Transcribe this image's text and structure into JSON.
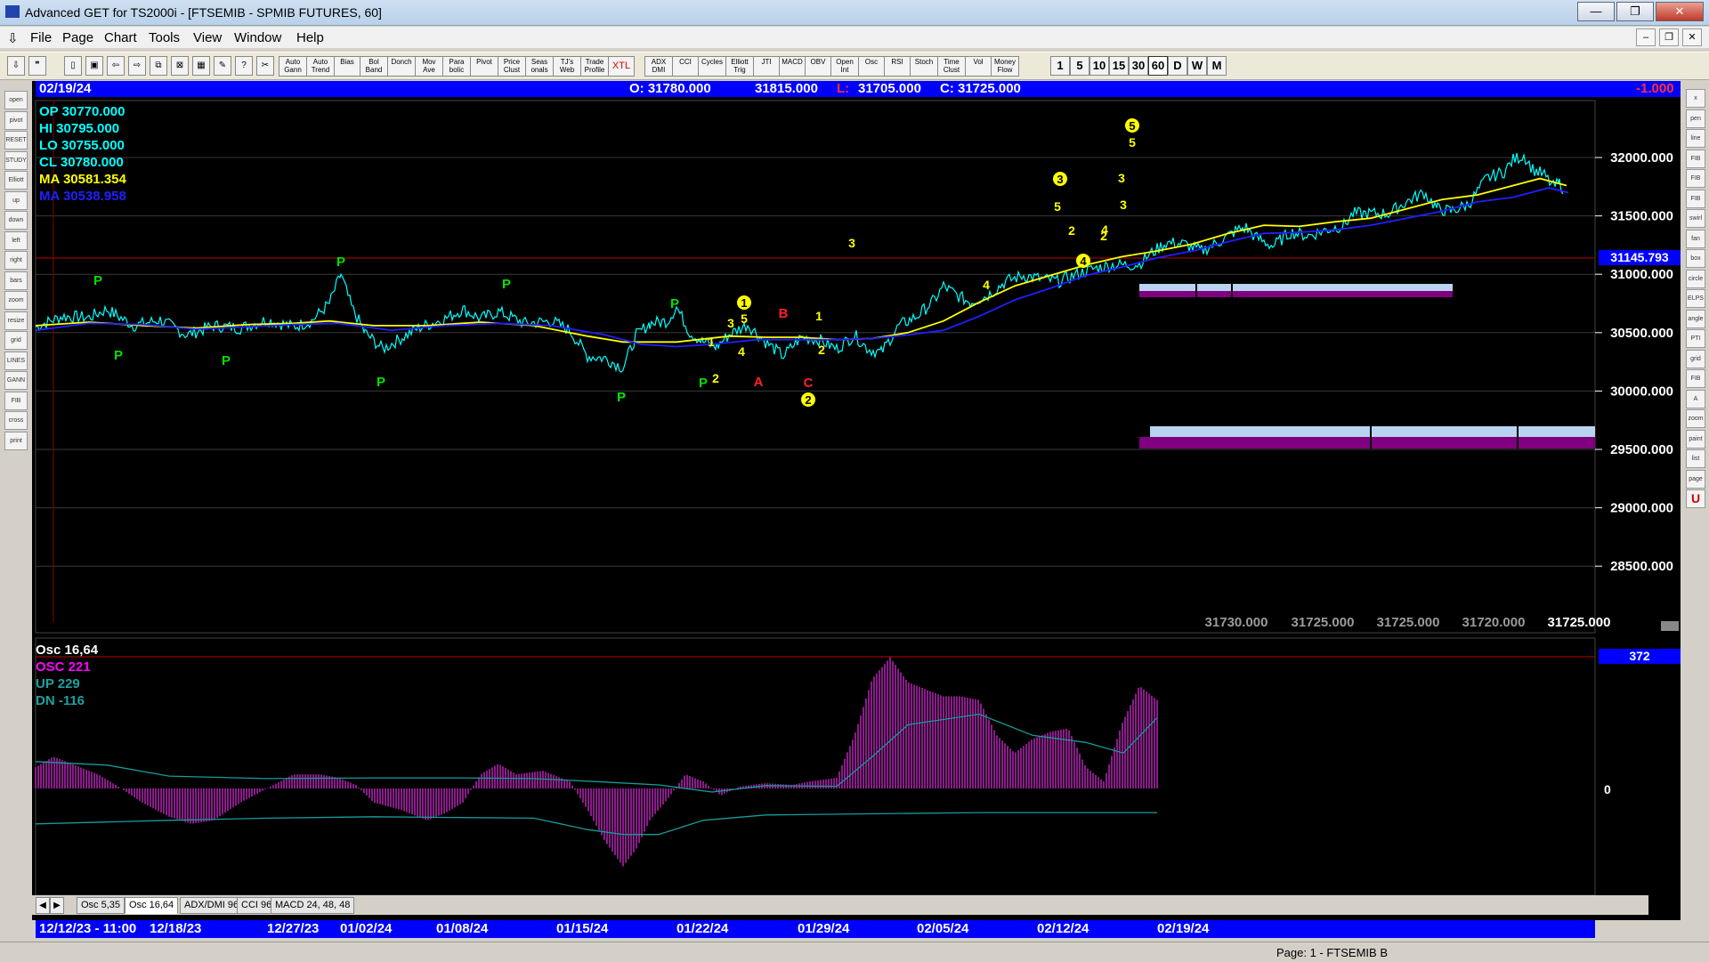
{
  "window": {
    "title": "Advanced GET for TS2000i - [FTSEMIB - SPMIB FUTURES, 60]",
    "min": "—",
    "restore": "❐",
    "close": "✕"
  },
  "menu": [
    "File",
    "Page",
    "Chart",
    "Tools",
    "View",
    "Window",
    "Help"
  ],
  "toolbar": {
    "study_buttons": [
      "Auto Gann",
      "Auto Trend",
      "Bias",
      "Bol Band",
      "Donch",
      "Mov Ave",
      "Para bolic",
      "Pivot",
      "Price Clust",
      "Seas onals",
      "TJ's Web",
      "Trade Profile",
      "XTL",
      "ADX DMI",
      "CCI",
      "Cycles",
      "Elliott Trig",
      "JTI",
      "MACD",
      "OBV",
      "Open Int",
      "Osc",
      "RSI",
      "Stoch",
      "Time Clust",
      "Vol",
      "Money Flow"
    ],
    "periods": [
      "1",
      "5",
      "10",
      "15",
      "30",
      "60",
      "D",
      "W",
      "M"
    ],
    "active_period": "60"
  },
  "info_bar": {
    "date": "02/19/24",
    "open": "O: 31780.000",
    "high": "31815.000",
    "low_label": "L:",
    "low": "31705.000",
    "close": "C: 31725.000",
    "change": "-1.000"
  },
  "price_panel": {
    "op": "OP  30770.000",
    "hi": "HI   30795.000",
    "lo": "LO  30755.000",
    "cl": "CL  30780.000",
    "ma1": "MA  30581.354",
    "ma2": "MA  30538.958",
    "y_ticks": [
      "32000.000",
      "31500.000",
      "31000.000",
      "30500.000",
      "30000.000",
      "29500.000",
      "29000.000",
      "28500.000"
    ],
    "current_price": "31145.793",
    "bottom_values": [
      "31730.000",
      "31725.000",
      "31725.000",
      "31720.000",
      "31725.000"
    ],
    "colors": {
      "price": "#00ffff",
      "ma_fast": "#ffff00",
      "ma_slow": "#2020ff",
      "pivot": "#00e000",
      "wave": "#ffff00",
      "abc": "#ff2020",
      "zone_top": "#b8d4f0",
      "zone_bottom": "#800080"
    }
  },
  "wave_labels": {
    "pivots": [
      "P",
      "P",
      "P",
      "P",
      "P",
      "P",
      "P",
      "P",
      "P",
      "P"
    ],
    "counts": [
      "3",
      "5",
      "4",
      "1",
      "2",
      "1",
      "2",
      "3",
      "4",
      "5",
      "3",
      "4",
      "2",
      "3",
      "5",
      "2"
    ],
    "abc": [
      "A",
      "B",
      "C"
    ],
    "circled": [
      "1",
      "2",
      "3",
      "4",
      "5"
    ]
  },
  "osc_panel": {
    "title": "Osc 16,64",
    "osc": "OSC 221",
    "up": "UP   229",
    "dn": "DN   -116",
    "max_value": "372",
    "zero_label": "0"
  },
  "tabs": [
    "Osc 5,35",
    "Osc 16,64",
    "ADX/DMI 96",
    "CCI 96",
    "MACD 24, 48, 48"
  ],
  "active_tab": "Osc 16,64",
  "date_axis": [
    "12/12/23 - 11:00",
    "12/18/23",
    "12/27/23",
    "01/02/24",
    "01/08/24",
    "01/15/24",
    "01/22/24",
    "01/29/24",
    "02/05/24",
    "02/12/24",
    "02/19/24"
  ],
  "status": {
    "page": "Page: 1 - FTSEMIB B"
  }
}
